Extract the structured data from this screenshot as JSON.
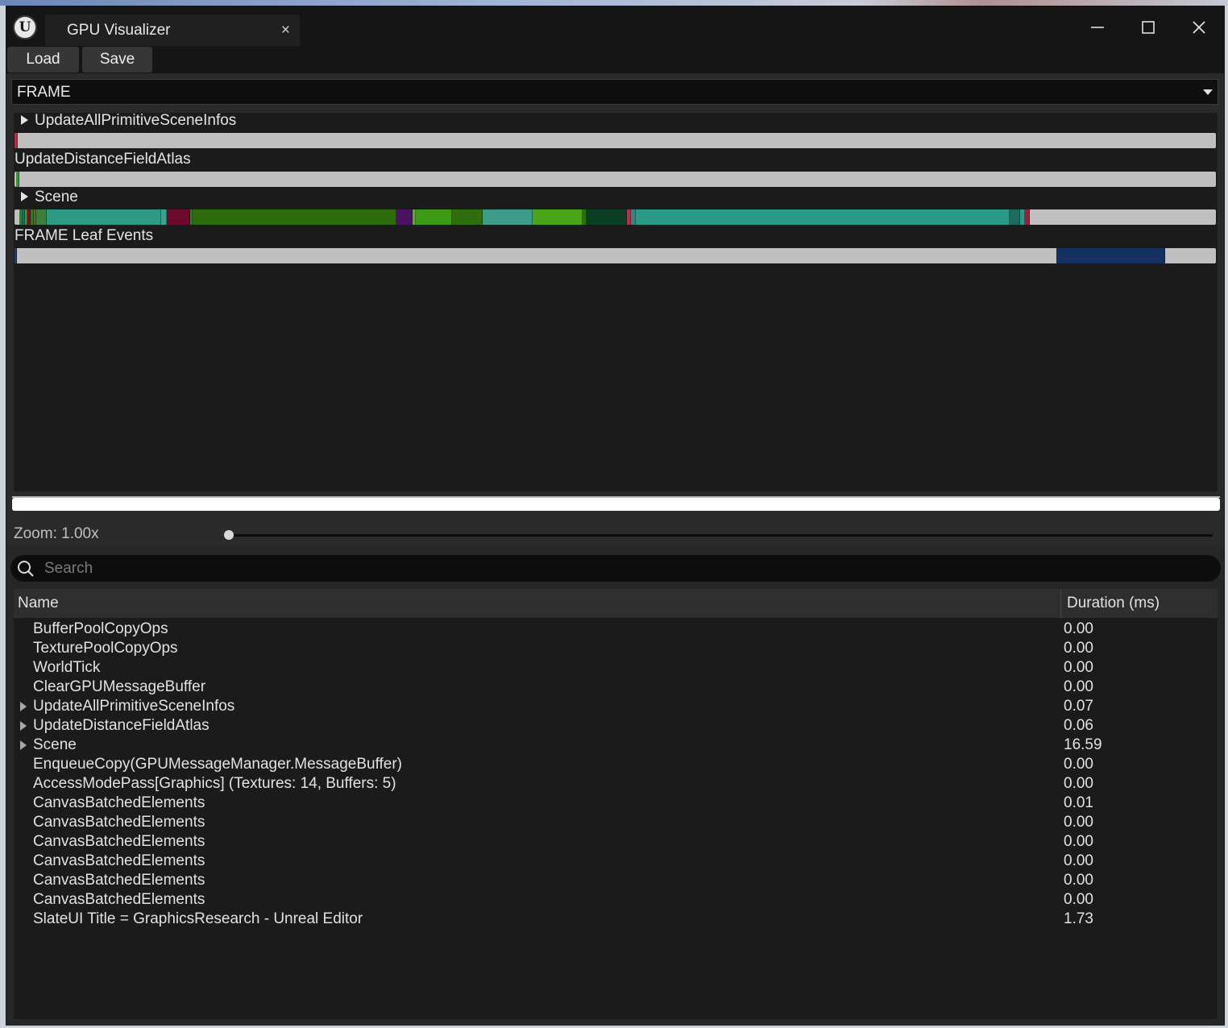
{
  "window": {
    "tab_title": "GPU Visualizer",
    "close_tab_glyph": "×",
    "minimize_glyph": "—",
    "maximize_glyph": "☐",
    "close_glyph": "✕",
    "logo_glyph": "U"
  },
  "toolbar": {
    "load_label": "Load",
    "save_label": "Save"
  },
  "frame_select": {
    "value": "FRAME"
  },
  "timeline": {
    "rows": [
      {
        "label": "UpdateAllPrimitiveSceneInfos",
        "expandable": true,
        "segments": [
          {
            "start": 0.0,
            "end": 0.0025,
            "color": "#b0304a"
          }
        ]
      },
      {
        "label": "UpdateDistanceFieldAtlas",
        "expandable": false,
        "segments": [
          {
            "start": 0.0015,
            "end": 0.004,
            "color": "#3f8f3a"
          }
        ]
      },
      {
        "label": "Scene",
        "expandable": true,
        "segments": [
          {
            "start": 0.004,
            "end": 0.007,
            "color": "#2e7d32"
          },
          {
            "start": 0.007,
            "end": 0.009,
            "color": "#1f6e5e"
          },
          {
            "start": 0.009,
            "end": 0.011,
            "color": "#3d9b2e"
          },
          {
            "start": 0.011,
            "end": 0.0135,
            "color": "#7a1030"
          },
          {
            "start": 0.0135,
            "end": 0.016,
            "color": "#2a7a2a"
          },
          {
            "start": 0.016,
            "end": 0.018,
            "color": "#556b2f"
          },
          {
            "start": 0.018,
            "end": 0.027,
            "color": "#3a7f3a"
          },
          {
            "start": 0.027,
            "end": 0.122,
            "color": "#2e9a84"
          },
          {
            "start": 0.122,
            "end": 0.127,
            "color": "#3aa290"
          },
          {
            "start": 0.127,
            "end": 0.146,
            "color": "#6b0a2a"
          },
          {
            "start": 0.146,
            "end": 0.148,
            "color": "#2e7d32"
          },
          {
            "start": 0.148,
            "end": 0.318,
            "color": "#2e6b0c"
          },
          {
            "start": 0.318,
            "end": 0.331,
            "color": "#4a1260"
          },
          {
            "start": 0.331,
            "end": 0.334,
            "color": "#6aa04a"
          },
          {
            "start": 0.334,
            "end": 0.364,
            "color": "#3c9a14"
          },
          {
            "start": 0.364,
            "end": 0.39,
            "color": "#2e6e0c"
          },
          {
            "start": 0.39,
            "end": 0.431,
            "color": "#3c9c8a"
          },
          {
            "start": 0.431,
            "end": 0.473,
            "color": "#4aa418"
          },
          {
            "start": 0.473,
            "end": 0.476,
            "color": "#2e6e0c"
          },
          {
            "start": 0.476,
            "end": 0.51,
            "color": "#0c3e26"
          },
          {
            "start": 0.51,
            "end": 0.513,
            "color": "#b83050"
          },
          {
            "start": 0.513,
            "end": 0.517,
            "color": "#2e8a7a"
          },
          {
            "start": 0.517,
            "end": 0.828,
            "color": "#2a9b86"
          },
          {
            "start": 0.828,
            "end": 0.837,
            "color": "#1d6b5e"
          },
          {
            "start": 0.837,
            "end": 0.841,
            "color": "#2a9b86"
          },
          {
            "start": 0.841,
            "end": 0.845,
            "color": "#9a2040"
          }
        ]
      },
      {
        "label": "FRAME Leaf Events",
        "expandable": false,
        "segments": [
          {
            "start": 0.0,
            "end": 0.002,
            "color": "#1e3a66"
          },
          {
            "start": 0.867,
            "end": 0.958,
            "color": "#14305e"
          }
        ]
      }
    ]
  },
  "zoom": {
    "label": "Zoom: 1.00x",
    "value": 1.0
  },
  "search": {
    "placeholder": "Search"
  },
  "table": {
    "columns": {
      "name": "Name",
      "duration": "Duration (ms)"
    },
    "rows": [
      {
        "name": "BufferPoolCopyOps",
        "duration": "0.00",
        "expandable": false
      },
      {
        "name": "TexturePoolCopyOps",
        "duration": "0.00",
        "expandable": false
      },
      {
        "name": "WorldTick",
        "duration": "0.00",
        "expandable": false
      },
      {
        "name": "ClearGPUMessageBuffer",
        "duration": "0.00",
        "expandable": false
      },
      {
        "name": "UpdateAllPrimitiveSceneInfos",
        "duration": "0.07",
        "expandable": true
      },
      {
        "name": "UpdateDistanceFieldAtlas",
        "duration": "0.06",
        "expandable": true
      },
      {
        "name": "Scene",
        "duration": "16.59",
        "expandable": true
      },
      {
        "name": "EnqueueCopy(GPUMessageManager.MessageBuffer)",
        "duration": "0.00",
        "expandable": false
      },
      {
        "name": "AccessModePass[Graphics] (Textures: 14, Buffers: 5)",
        "duration": "0.00",
        "expandable": false
      },
      {
        "name": "CanvasBatchedElements",
        "duration": "0.01",
        "expandable": false
      },
      {
        "name": "CanvasBatchedElements",
        "duration": "0.00",
        "expandable": false
      },
      {
        "name": "CanvasBatchedElements",
        "duration": "0.00",
        "expandable": false
      },
      {
        "name": "CanvasBatchedElements",
        "duration": "0.00",
        "expandable": false
      },
      {
        "name": "CanvasBatchedElements",
        "duration": "0.00",
        "expandable": false
      },
      {
        "name": "CanvasBatchedElements",
        "duration": "0.00",
        "expandable": false
      },
      {
        "name": "SlateUI Title = GraphicsResearch - Unreal Editor",
        "duration": "1.73",
        "expandable": false
      }
    ]
  }
}
